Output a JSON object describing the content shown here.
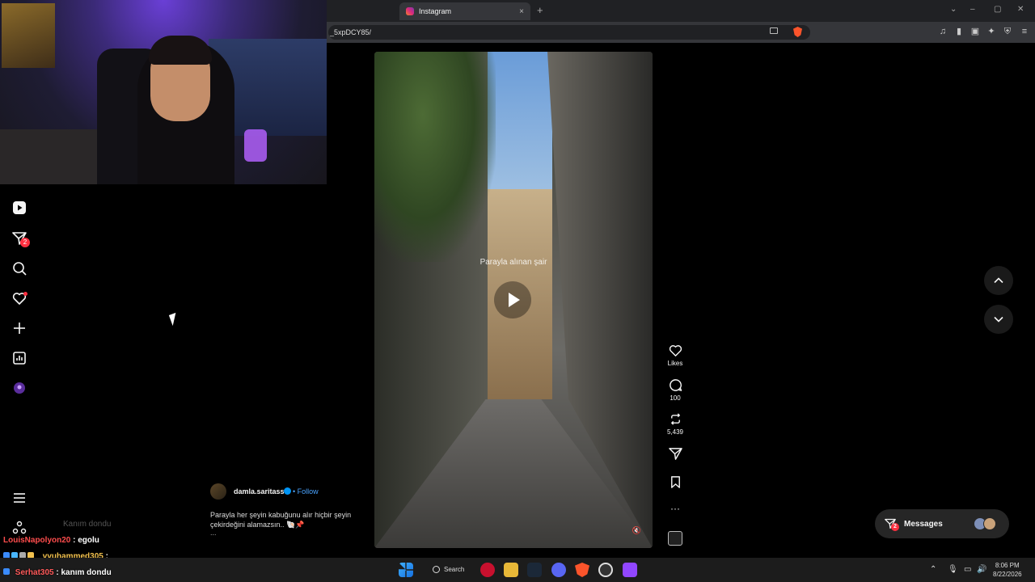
{
  "browser": {
    "tab_title": "Instagram",
    "tab_close": "×",
    "new_tab": "+",
    "url_fragment": "_5xpDCY85/",
    "window_controls": [
      "⌄",
      "–",
      "▢",
      "✕"
    ]
  },
  "sidebar": {
    "items": [
      {
        "name": "reels",
        "icon": "reels-icon"
      },
      {
        "name": "messages",
        "icon": "paper-plane-icon",
        "badge": "2"
      },
      {
        "name": "search",
        "icon": "search-icon"
      },
      {
        "name": "notifications",
        "icon": "heart-icon"
      },
      {
        "name": "create",
        "icon": "plus-icon"
      },
      {
        "name": "dashboard",
        "icon": "chart-icon"
      },
      {
        "name": "profile",
        "icon": "avatar-icon"
      },
      {
        "name": "more",
        "icon": "menu-icon"
      },
      {
        "name": "apps",
        "icon": "apps-icon"
      }
    ]
  },
  "reel": {
    "caption_overlay": "Parayla alınan şair",
    "play_icon": "play-icon",
    "mute_icon": "🔇"
  },
  "actions": {
    "like_label": "Likes",
    "comment_count": "100",
    "repost_count": "5,439"
  },
  "author": {
    "username": "damla.saritass",
    "follow": "• Follow",
    "description": "Parayla her şeyin kabuğunu alır hiçbir şeyin çekirdeğini alamazsın.. 🐚📌",
    "more": "..."
  },
  "messages": {
    "label": "Messages",
    "badge": "2"
  },
  "chat": [
    {
      "name": "",
      "text": "Kanım dondu"
    },
    {
      "name": "LouisNapolyon20",
      "text": ": egolu"
    },
    {
      "name": "vvuhammed305",
      "text": ":"
    },
    {
      "name": "Serhat305",
      "text": ": kanım dondu"
    }
  ],
  "taskbar": {
    "search_label": "Search",
    "time": "8:06 PM",
    "date": "8/22/2026"
  },
  "colors": {
    "accent": "#0095f6",
    "badge": "#ff3040",
    "background": "#000000"
  }
}
